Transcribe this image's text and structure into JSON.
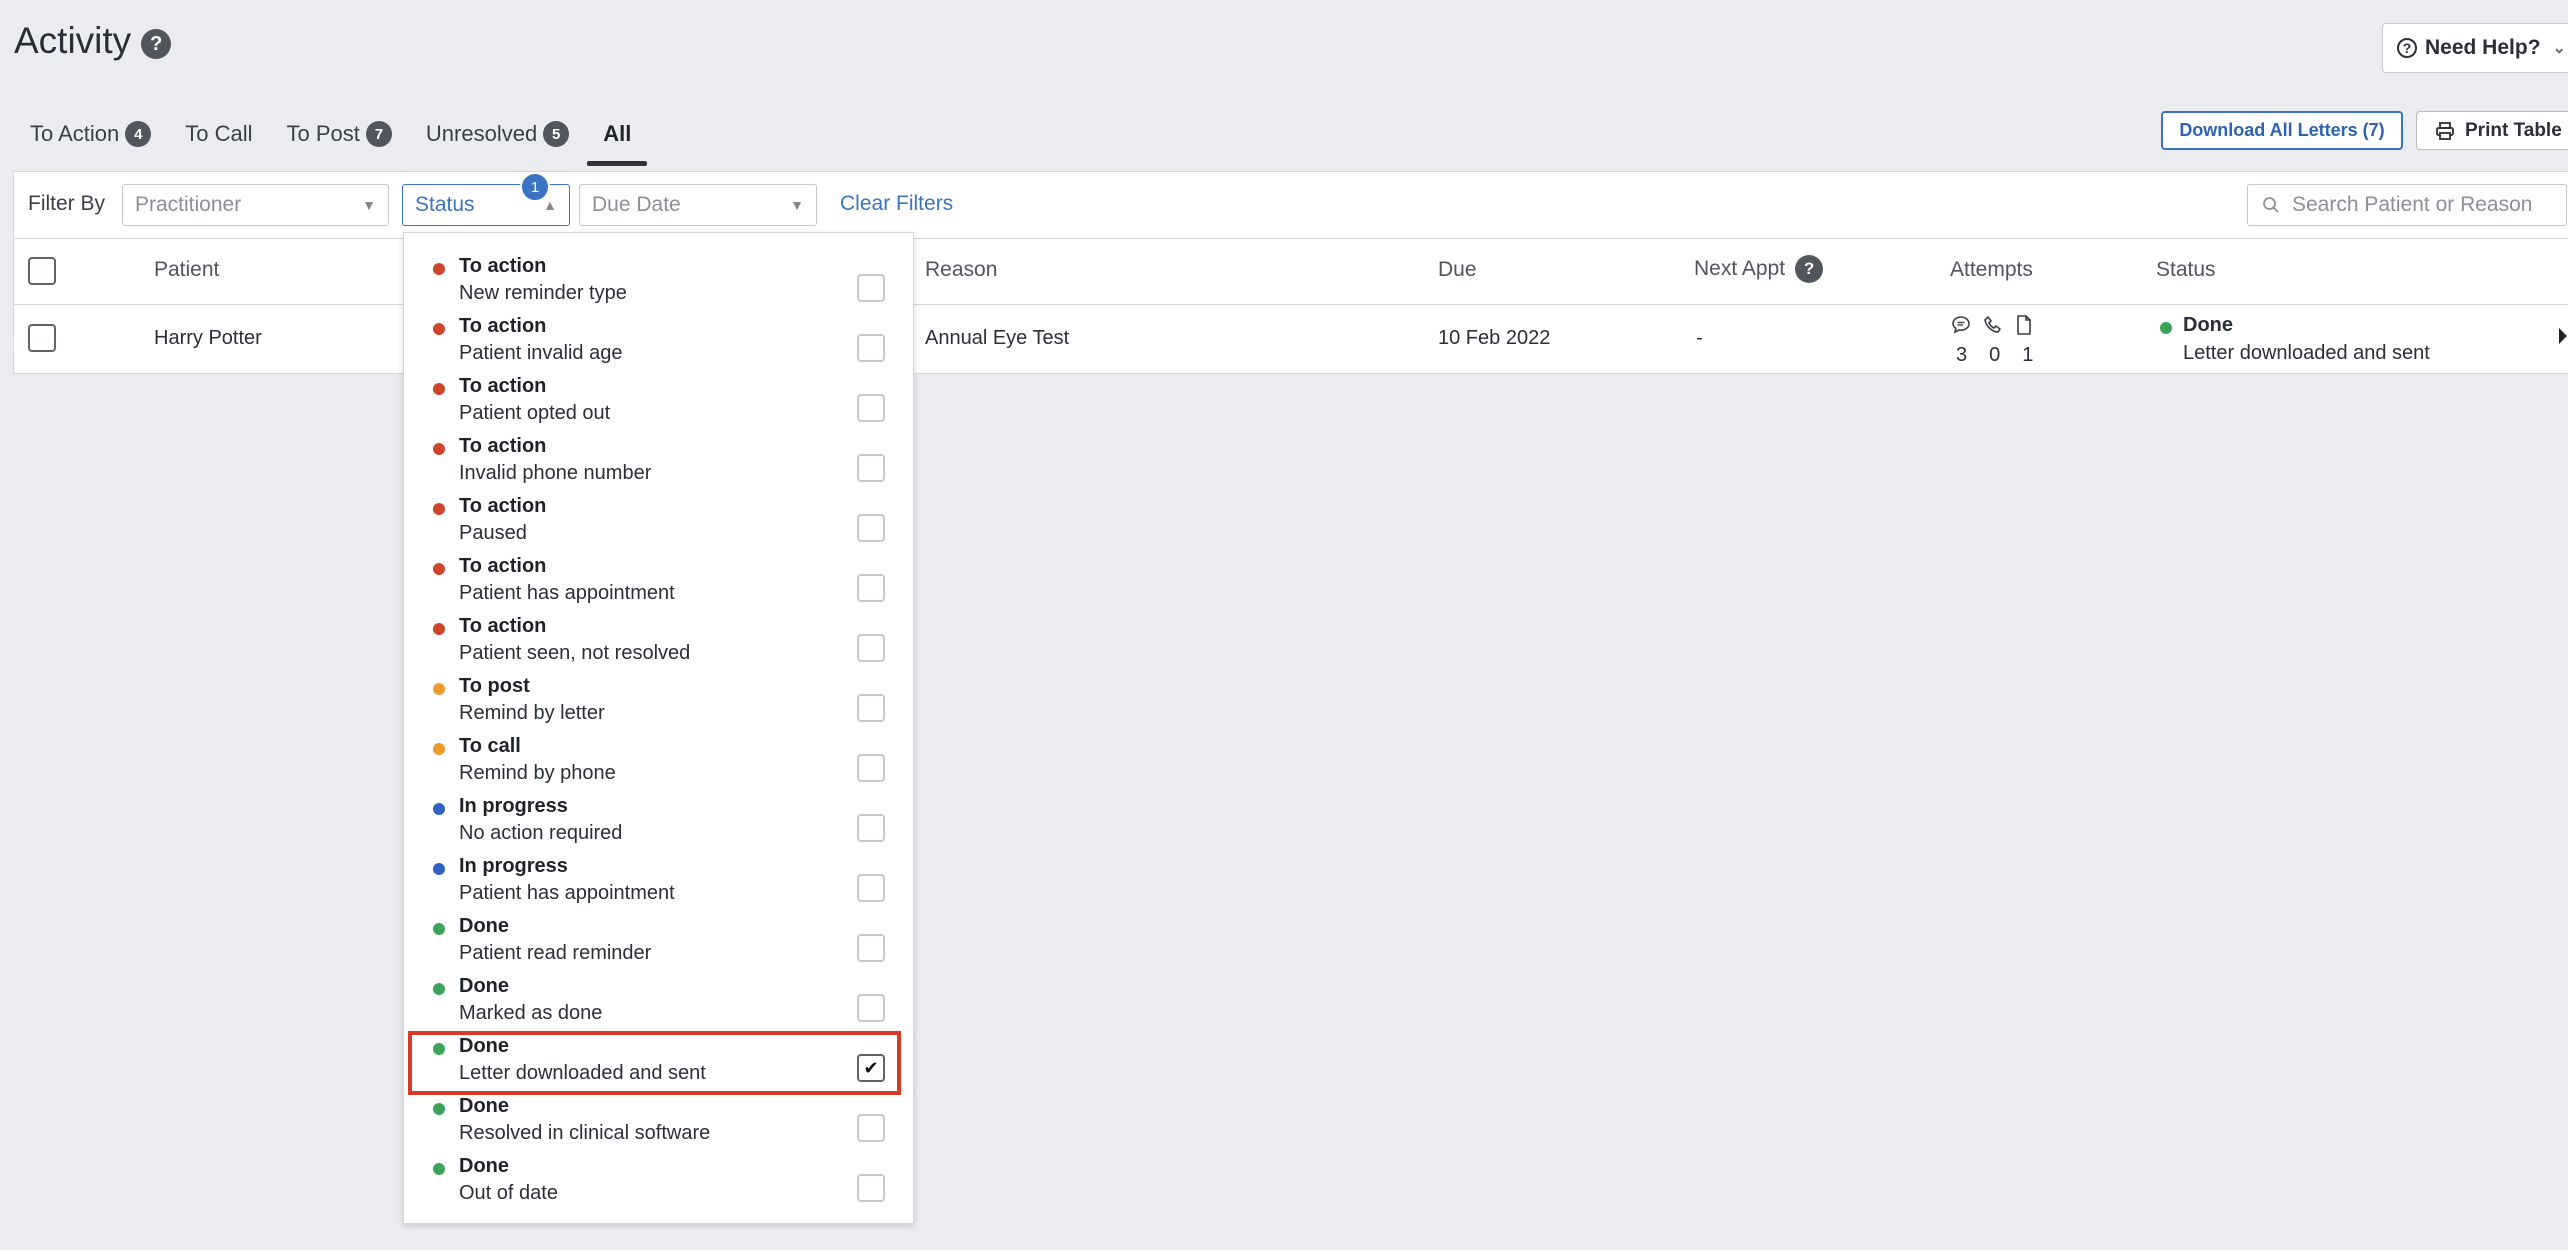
{
  "page": {
    "title": "Activity"
  },
  "help": {
    "label": "Need Help?"
  },
  "tabs": [
    {
      "label": "To Action",
      "count": "4"
    },
    {
      "label": "To Call",
      "count": ""
    },
    {
      "label": "To Post",
      "count": "7"
    },
    {
      "label": "Unresolved",
      "count": "5"
    },
    {
      "label": "All",
      "count": ""
    }
  ],
  "actions": {
    "download": "Download All Letters (7)",
    "print": "Print Table"
  },
  "filters": {
    "label": "Filter By",
    "practitioner": "Practitioner",
    "status": "Status",
    "status_count": "1",
    "due_date": "Due Date",
    "clear": "Clear Filters",
    "search_placeholder": "Search Patient or Reason"
  },
  "table": {
    "headers": {
      "patient": "Patient",
      "reason": "Reason",
      "due": "Due",
      "next_appt": "Next Appt",
      "attempts": "Attempts",
      "status": "Status"
    },
    "row": {
      "patient": "Harry Potter",
      "reason": "Annual Eye Test",
      "due": "10 Feb 2022",
      "next_appt": "-",
      "attempts": {
        "sms": "3",
        "phone": "0",
        "letter": "1"
      },
      "status_title": "Done",
      "status_sub": "Letter downloaded and sent",
      "status_color": "#3ea35a"
    }
  },
  "status_options": [
    {
      "title": "To action",
      "sub": "New reminder type",
      "color": "#d0452b",
      "checked": false
    },
    {
      "title": "To action",
      "sub": "Patient invalid age",
      "color": "#d0452b",
      "checked": false
    },
    {
      "title": "To action",
      "sub": "Patient opted out",
      "color": "#d0452b",
      "checked": false
    },
    {
      "title": "To action",
      "sub": "Invalid phone number",
      "color": "#d0452b",
      "checked": false
    },
    {
      "title": "To action",
      "sub": "Paused",
      "color": "#d0452b",
      "checked": false
    },
    {
      "title": "To action",
      "sub": "Patient has appointment",
      "color": "#d0452b",
      "checked": false
    },
    {
      "title": "To action",
      "sub": "Patient seen, not resolved",
      "color": "#d0452b",
      "checked": false
    },
    {
      "title": "To post",
      "sub": "Remind by letter",
      "color": "#ef9a2d",
      "checked": false
    },
    {
      "title": "To call",
      "sub": "Remind by phone",
      "color": "#ef9a2d",
      "checked": false
    },
    {
      "title": "In progress",
      "sub": "No action required",
      "color": "#2f64c4",
      "checked": false
    },
    {
      "title": "In progress",
      "sub": "Patient has appointment",
      "color": "#2f64c4",
      "checked": false
    },
    {
      "title": "Done",
      "sub": "Patient read reminder",
      "color": "#3ea35a",
      "checked": false
    },
    {
      "title": "Done",
      "sub": "Marked as done",
      "color": "#3ea35a",
      "checked": false
    },
    {
      "title": "Done",
      "sub": "Letter downloaded and sent",
      "color": "#3ea35a",
      "checked": true
    },
    {
      "title": "Done",
      "sub": "Resolved in clinical software",
      "color": "#3ea35a",
      "checked": false
    },
    {
      "title": "Done",
      "sub": "Out of date",
      "color": "#3ea35a",
      "checked": false
    }
  ]
}
